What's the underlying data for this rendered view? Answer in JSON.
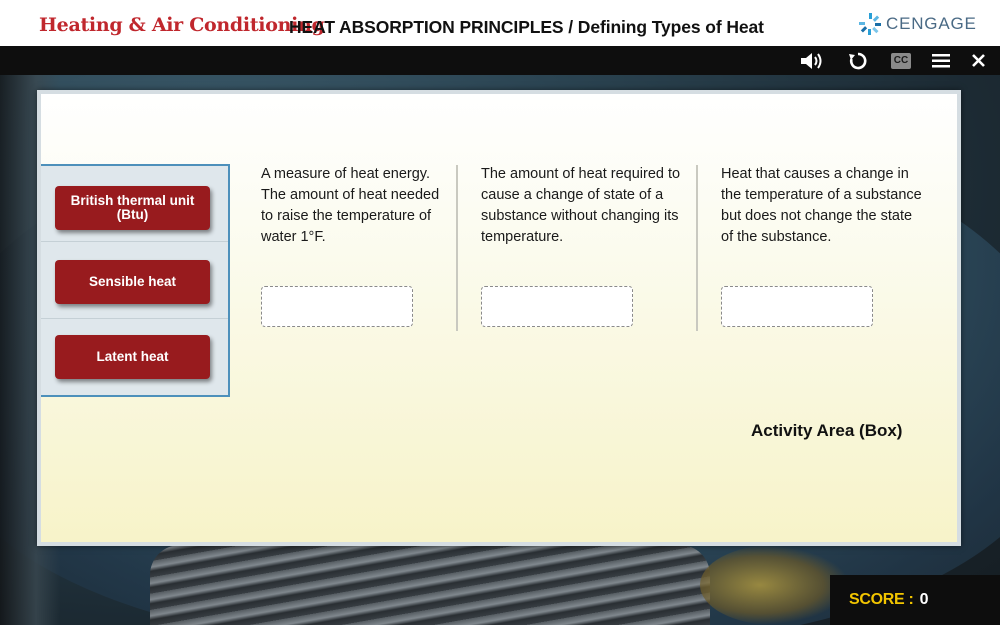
{
  "header": {
    "course_title": "Heating & Air Conditioning",
    "breadcrumb": "HEAT ABSORPTION PRINCIPLES / Defining Types of Heat",
    "logo_text": "CENGAGE",
    "logo_icon": "cengage-logo-icon"
  },
  "controls": {
    "audio_icon": "speaker-icon",
    "replay_icon": "replay-icon",
    "cc_label": "CC",
    "menu_icon": "hamburger-menu-icon",
    "close_icon": "close-icon"
  },
  "activity": {
    "terms": [
      {
        "label": "British thermal unit (Btu)"
      },
      {
        "label": "Sensible heat"
      },
      {
        "label": "Latent heat"
      }
    ],
    "definitions": [
      {
        "text": "A measure of heat energy. The amount of heat needed to raise the temperature of water 1°F."
      },
      {
        "text": "The amount of heat required to cause a change of state of a substance without changing its temperature."
      },
      {
        "text": "Heat that causes a change in the temperature of a substance but does not change the state of the substance."
      }
    ],
    "area_label": "Activity Area (Box)"
  },
  "score": {
    "label": "SCORE :",
    "value": "0"
  },
  "colors": {
    "brand_red": "#c0272d",
    "term_button": "#981b1e",
    "score_yellow": "#f2c500",
    "source_border": "#4d90bb"
  }
}
